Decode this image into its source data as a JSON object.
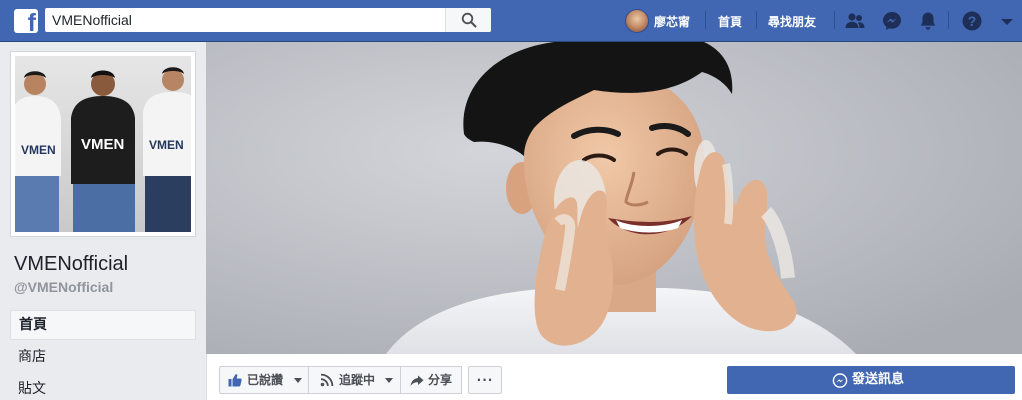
{
  "topbar": {
    "logo": "f",
    "search_value": "VMENofficial",
    "profile_name": "廖芯甯",
    "nav_home": "首頁",
    "nav_find_friends": "尋找朋友",
    "icons": [
      "friend-requests-icon",
      "messenger-icon",
      "notifications-icon",
      "help-icon",
      "account-menu-icon"
    ],
    "accent": "#4267b2"
  },
  "sidebar": {
    "page_name": "VMENofficial",
    "page_handle": "@VMENofficial",
    "items": [
      {
        "label": "首頁",
        "active": true
      },
      {
        "label": "商店",
        "active": false
      },
      {
        "label": "貼文",
        "active": false
      }
    ],
    "profile_pic_text": [
      "VMEN",
      "VMEN",
      "VMEN"
    ]
  },
  "actions": {
    "like_label": "已說讚",
    "follow_label": "追蹤中",
    "share_label": "分享",
    "more_label": "···",
    "message_label": "發送訊息"
  }
}
